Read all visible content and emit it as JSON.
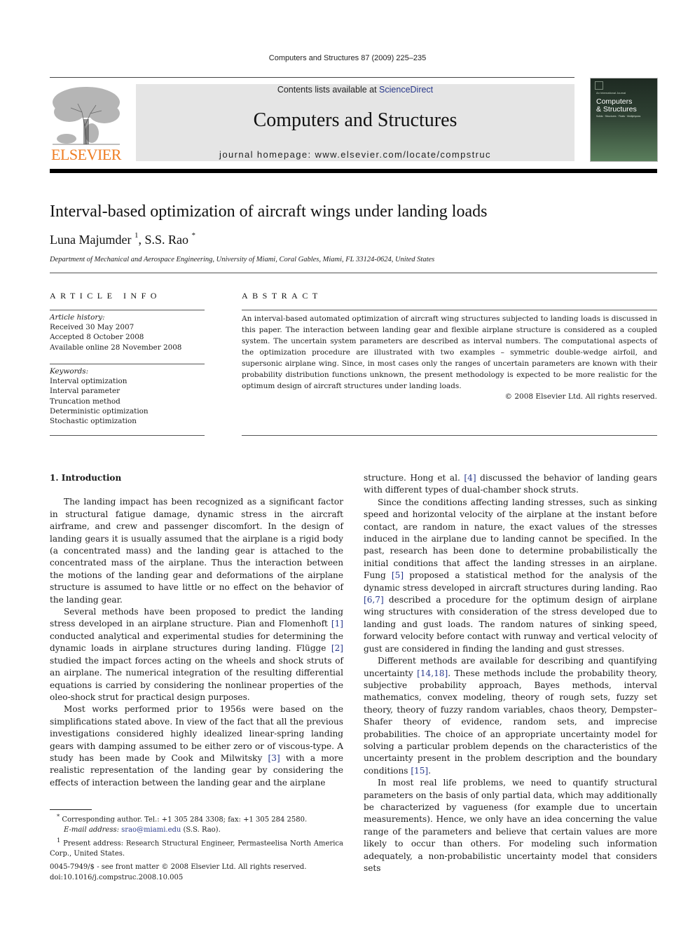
{
  "header": {
    "citation": "Computers and Structures 87 (2009) 225–235",
    "contents_prefix": "Contents lists available at ",
    "contents_link": "ScienceDirect",
    "journal_title": "Computers and Structures",
    "homepage": "journal homepage: www.elsevier.com/locate/compstruc",
    "publisher_logo_text": "ELSEVIER",
    "cover": {
      "kicker": "An International Journal",
      "title_line1": "Computers",
      "title_line2": "& Structures",
      "subtitle": "Solids · Structures · Fluids · Multiphysics"
    },
    "colors": {
      "publisher_orange": "#ef7d22",
      "link_blue": "#2a3a8c",
      "banner_gray": "#e5e5e5"
    }
  },
  "article": {
    "title": "Interval-based optimization of aircraft wings under landing loads",
    "authors": [
      {
        "name": "Luna Majumder",
        "mark": "1"
      },
      {
        "name": "S.S. Rao",
        "mark": "*"
      }
    ],
    "author_separator": ", ",
    "affiliation": "Department of Mechanical and Aerospace Engineering, University of Miami, Coral Gables, Miami, FL 33124-0624, United States"
  },
  "article_info": {
    "label": "ARTICLE INFO",
    "history_label": "Article history:",
    "history": [
      "Received 30 May 2007",
      "Accepted 8 October 2008",
      "Available online 28 November 2008"
    ],
    "keywords_label": "Keywords:",
    "keywords": [
      "Interval optimization",
      "Interval parameter",
      "Truncation method",
      "Deterministic optimization",
      "Stochastic optimization"
    ]
  },
  "abstract": {
    "label": "ABSTRACT",
    "text": "An interval-based automated optimization of aircraft wing structures subjected to landing loads is discussed in this paper. The interaction between landing gear and flexible airplane structure is considered as a coupled system. The uncertain system parameters are described as interval numbers. The computational aspects of the optimization procedure are illustrated with two examples – symmetric double-wedge airfoil, and supersonic airplane wing. Since, in most cases only the ranges of uncertain parameters are known with their probability distribution functions unknown, the present methodology is expected to be more realistic for the optimum design of aircraft structures under landing loads.",
    "copyright": "© 2008 Elsevier Ltd. All rights reserved."
  },
  "body": {
    "section_heading": "1. Introduction",
    "left_paragraphs": [
      {
        "parts": [
          {
            "t": "The landing impact has been recognized as a significant factor in structural fatigue damage, dynamic stress in the aircraft airframe, and crew and passenger discomfort. In the design of landing gears it is usually assumed that the airplane is a rigid body (a concentrated mass) and the landing gear is attached to the concentrated mass of the airplane. Thus the interaction between the motions of the landing gear and deformations of the airplane structure is assumed to have little or no effect on the behavior of the landing gear."
          }
        ]
      },
      {
        "parts": [
          {
            "t": "Several methods have been proposed to predict the landing stress developed in an airplane structure. Pian and Flomenhoft "
          },
          {
            "r": "[1]"
          },
          {
            "t": " conducted analytical and experimental studies for determining the dynamic loads in airplane structures during landing. Flügge "
          },
          {
            "r": "[2]"
          },
          {
            "t": " studied the impact forces acting on the wheels and shock struts of an airplane. The numerical integration of the resulting differential equations is carried by considering the nonlinear properties of the oleo-shock strut for practical design purposes."
          }
        ]
      },
      {
        "parts": [
          {
            "t": "Most works performed prior to 1956s were based on the simplifications stated above. In view of the fact that all the previous investigations considered highly idealized linear-spring landing gears with damping assumed to be either zero or of viscous-type. A study has been made by Cook and Milwitsky "
          },
          {
            "r": "[3]"
          },
          {
            "t": " with a more realistic representation of the landing gear by considering the effects of interaction between the landing gear and the airplane"
          }
        ]
      }
    ],
    "right_paragraphs": [
      {
        "noindent": true,
        "parts": [
          {
            "t": "structure. Hong et al. "
          },
          {
            "r": "[4]"
          },
          {
            "t": " discussed the behavior of landing gears with different types of dual-chamber shock struts."
          }
        ]
      },
      {
        "parts": [
          {
            "t": "Since the conditions affecting landing stresses, such as sinking speed and horizontal velocity of the airplane at the instant before contact, are random in nature, the exact values of the stresses induced in the airplane due to landing cannot be specified. In the past, research has been done to determine probabilistically the initial conditions that affect the landing stresses in an airplane. Fung "
          },
          {
            "r": "[5]"
          },
          {
            "t": " proposed a statistical method for the analysis of the dynamic stress developed in aircraft structures during landing. Rao "
          },
          {
            "r": "[6,7]"
          },
          {
            "t": " described a procedure for the optimum design of airplane wing structures with consideration of the stress developed due to landing and gust loads. The random natures of sinking speed, forward velocity before contact with runway and vertical velocity of gust are considered in finding the landing and gust stresses."
          }
        ]
      },
      {
        "parts": [
          {
            "t": "Different methods are available for describing and quantifying uncertainty "
          },
          {
            "r": "[14,18]"
          },
          {
            "t": ". These methods include the probability theory, subjective probability approach, Bayes methods, interval mathematics, convex modeling, theory of rough sets, fuzzy set theory, theory of fuzzy random variables, chaos theory, Dempster–Shafer theory of evidence, random sets, and imprecise probabilities. The choice of an appropriate uncertainty model for solving a particular problem depends on the characteristics of the uncertainty present in the problem description and the boundary conditions "
          },
          {
            "r": "[15]"
          },
          {
            "t": "."
          }
        ]
      },
      {
        "parts": [
          {
            "t": "In most real life problems, we need to quantify structural parameters on the basis of only partial data, which may additionally be characterized by vagueness (for example due to uncertain measurements). Hence, we only have an idea concerning the value range of the parameters and believe that certain values are more likely to occur than others. For modeling such information adequately, a non-probabilistic uncertainty model that considers sets"
          }
        ]
      }
    ]
  },
  "footnotes": {
    "corresponding_mark": "*",
    "corresponding": "Corresponding author. Tel.: +1 305 284 3308; fax: +1 305 284 2580.",
    "email_label": "E-mail address:",
    "email": "srao@miami.edu",
    "email_owner": "(S.S. Rao).",
    "present_mark": "1",
    "present_address": "Present address: Research Structural Engineer, Permasteelisa North America Corp., United States."
  },
  "front_matter": {
    "issn_line": "0045-7949/$ - see front matter © 2008 Elsevier Ltd. All rights reserved.",
    "doi": "doi:10.1016/j.compstruc.2008.10.005"
  }
}
